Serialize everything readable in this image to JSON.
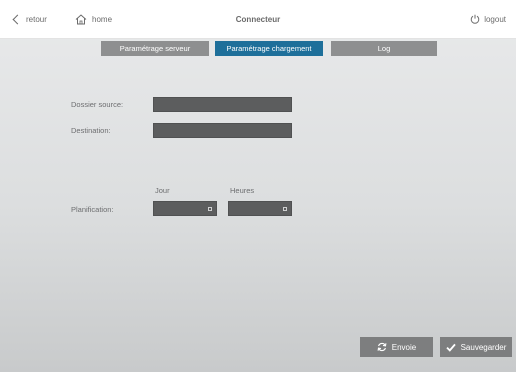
{
  "topbar": {
    "back_label": "retour",
    "home_label": "home",
    "title": "Connecteur",
    "logout_label": "logout"
  },
  "tabs": [
    {
      "label": "Paramétrage serveur",
      "active": false
    },
    {
      "label": "Paramétrage chargement",
      "active": true
    },
    {
      "label": "Log",
      "active": false
    }
  ],
  "form": {
    "source_label": "Dossier source:",
    "source_value": "",
    "destination_label": "Destination:",
    "destination_value": "",
    "planning_label": "Planification:",
    "day_header": "Jour",
    "hours_header": "Heures",
    "day_value": "",
    "hours_value": ""
  },
  "actions": {
    "send_label": "Envoie",
    "save_label": "Sauvegarder"
  },
  "colors": {
    "active_tab": "#1e6f9a",
    "inactive_tab": "#8e8f90",
    "field_bg": "#5c5d5e"
  }
}
